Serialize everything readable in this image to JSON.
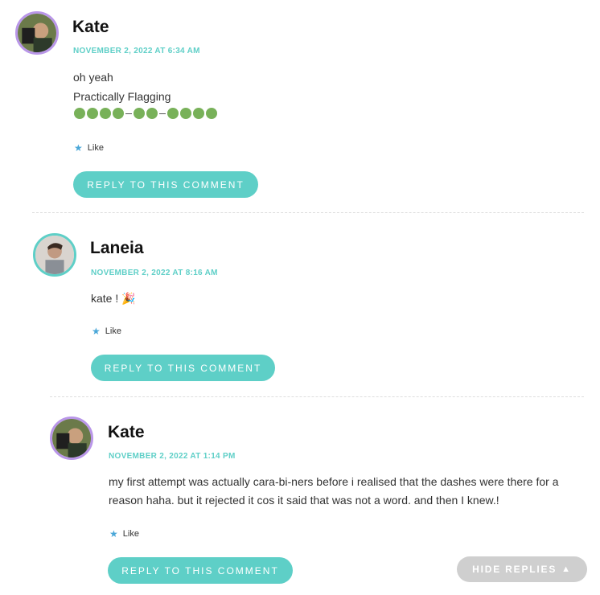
{
  "comments": [
    {
      "author": "Kate",
      "date": "NOVEMBER 2, 2022 AT 6:34 AM",
      "lines": [
        "oh yeah",
        "Practically Flagging"
      ],
      "like_label": "Like",
      "reply_label": "REPLY TO THIS COMMENT"
    },
    {
      "author": "Laneia",
      "date": "NOVEMBER 2, 2022 AT 8:16 AM",
      "lines": [
        "kate ! 🎉"
      ],
      "like_label": "Like",
      "reply_label": "REPLY TO THIS COMMENT"
    },
    {
      "author": "Kate",
      "date": "NOVEMBER 2, 2022 AT 1:14 PM",
      "text": "my first attempt was actually cara-bi-ners before i realised that the dashes were there for a reason haha. but it rejected it cos it said that was not a word. and then I knew.!",
      "like_label": "Like",
      "reply_label": "REPLY TO THIS COMMENT"
    }
  ],
  "hide_replies_label": "HIDE REPLIES",
  "icons": {
    "like": "star-icon",
    "hide": "triangle-up-icon"
  },
  "colors": {
    "accent": "#5ecfc7",
    "avatar_ring_kate": "#b996e8",
    "dots": "#78b159",
    "hide_button": "#cfcfcf"
  }
}
